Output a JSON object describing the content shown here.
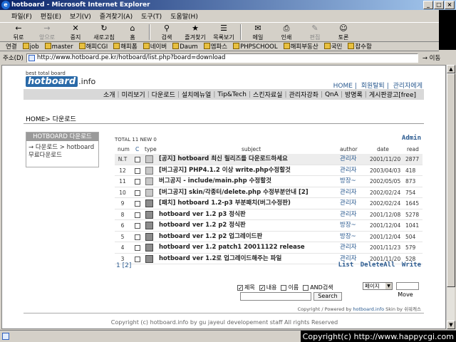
{
  "window": {
    "title": "hotboard - Microsoft Internet Explorer"
  },
  "menu": [
    "파일(F)",
    "편집(E)",
    "보기(V)",
    "즐겨찾기(A)",
    "도구(T)",
    "도움말(H)"
  ],
  "toolbar": [
    {
      "label": "뒤로",
      "icon": "←"
    },
    {
      "label": "앞으로",
      "icon": "→"
    },
    {
      "label": "중지",
      "icon": "✕"
    },
    {
      "label": "새로고침",
      "icon": "↻"
    },
    {
      "label": "홈",
      "icon": "⌂"
    },
    {
      "label": "검색",
      "icon": "⚲"
    },
    {
      "label": "즐겨찾기",
      "icon": "★"
    },
    {
      "label": "목록보기",
      "icon": "☰"
    },
    {
      "label": "메일",
      "icon": "✉"
    },
    {
      "label": "인쇄",
      "icon": "⎙"
    },
    {
      "label": "편집",
      "icon": "✎"
    },
    {
      "label": "토론",
      "icon": "☺"
    }
  ],
  "links": {
    "label": "연결",
    "items": [
      "job",
      "master",
      "해피CGI",
      "해피폼",
      "네이버",
      "Daum",
      "엠파스",
      "PHPSCHOOL",
      "해피부동산",
      "국민",
      "잡수함"
    ]
  },
  "address": {
    "label": "주소(D)",
    "url": "http://www.hotboard.pe.kr/hotboard/list.php?board=download",
    "go": "이동"
  },
  "site": {
    "tagline": "best total board",
    "logo": "hotboard",
    "logo_suffix": ".info",
    "toplinks": [
      "HOME",
      "회원탈퇴",
      "관리자에게"
    ],
    "nav": [
      "소개",
      "미리보기",
      "다운로드",
      "설치메뉴얼",
      "Tip&Tech",
      "스킨자료실",
      "관리자강좌",
      "QnA",
      "방명록",
      "게시판광고[free]"
    ],
    "breadcrumb": "HOME> 다운로드"
  },
  "sidebar": {
    "header": "HOTBOARD 다운로드",
    "line1": "→ 다운로드 > hotboard",
    "line2": "무료다운로드"
  },
  "board": {
    "count": "TOTAL 11 NEW 0",
    "admin": "Admin",
    "headers": {
      "num": "num",
      "c": "C",
      "type": "type",
      "subject": "subject",
      "author": "author",
      "date": "date",
      "read": "read"
    },
    "rows": [
      {
        "num": "N.T",
        "subject": "[공지] hotboard 최신 릴리즈를 다운로드하세요",
        "author": "관리자",
        "date": "2001/11/20",
        "read": "2877",
        "type": "doc"
      },
      {
        "num": "12",
        "subject": "[버그공지] PHP4.1.2 이상 write.php수정할것",
        "author": "관리자",
        "date": "2003/04/03",
        "read": "418",
        "type": "doc"
      },
      {
        "num": "11",
        "subject": "버그공지 - include/main.php 수정할것",
        "author": "방장~",
        "date": "2002/05/05",
        "read": "873",
        "type": "doc"
      },
      {
        "num": "10",
        "subject": "[버그공지] skin/각종터/delete.php 수정부분안내 [2]",
        "author": "관리자",
        "date": "2002/02/24",
        "read": "754",
        "type": "doc"
      },
      {
        "num": "9",
        "subject": "[패치] hotboard 1.2-p3 부분패치(버그수정판)",
        "author": "관리자",
        "date": "2002/02/24",
        "read": "1645",
        "type": "disk"
      },
      {
        "num": "8",
        "subject": "hotboard ver 1.2 p3 정식판",
        "author": "관리자",
        "date": "2001/12/08",
        "read": "5278",
        "type": "disk"
      },
      {
        "num": "6",
        "subject": "hotboard ver 1.2 p2 정식판",
        "author": "방장~",
        "date": "2001/12/04",
        "read": "1041",
        "type": "disk"
      },
      {
        "num": "5",
        "subject": "hotboard ver 1.2 p2 업그레이드판",
        "author": "방장~",
        "date": "2001/12/04",
        "read": "504",
        "type": "disk"
      },
      {
        "num": "4",
        "subject": "hotboard ver 1.2 patch1 20011122 release",
        "author": "관리자",
        "date": "2001/11/23",
        "read": "579",
        "type": "disk"
      },
      {
        "num": "3",
        "subject": "hotboard ver 1.2로 업그레이드해주는 파일",
        "author": "관리자",
        "date": "2001/11/20",
        "read": "528",
        "type": "disk"
      }
    ],
    "pager": "1 [2]",
    "actions": [
      "List",
      "DeleteAll",
      "Write"
    ]
  },
  "search": {
    "options": [
      {
        "label": "제목",
        "checked": true
      },
      {
        "label": "내용",
        "checked": true
      },
      {
        "label": "이름",
        "checked": false
      },
      {
        "label": "AND검색",
        "checked": false
      }
    ],
    "button": "Search",
    "page_select": "페이지",
    "move": "Move"
  },
  "powered": {
    "prefix": "Copyright / Powered by",
    "link": "hotboard.info",
    "skin": "Skin by 쉬워캐스"
  },
  "footer": "Copyright (c) hotboard.info by gu jayeul developement staff All rights Reserved",
  "statusbar": {
    "copyright": "Copyright(c) http://www.happycgi.com"
  }
}
